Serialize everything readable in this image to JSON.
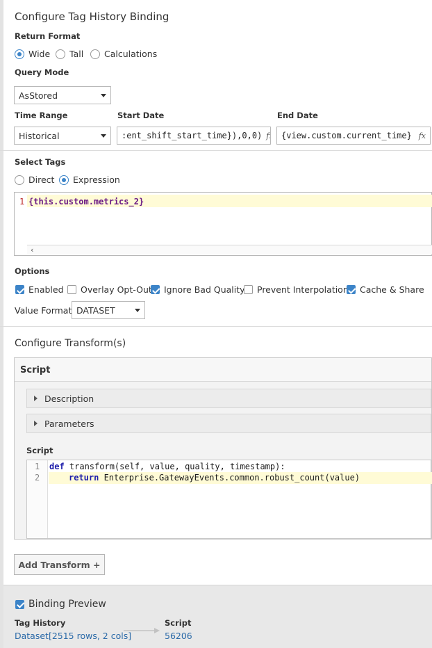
{
  "panel_title": "Configure Tag History Binding",
  "return_format": {
    "label": "Return Format",
    "options": [
      "Wide",
      "Tall",
      "Calculations"
    ],
    "selected": "Wide"
  },
  "query_mode": {
    "label": "Query Mode",
    "value": "AsStored"
  },
  "time_range": {
    "label": "Time Range",
    "value": "Historical"
  },
  "start_date": {
    "label": "Start Date",
    "value": ":ent_shift_start_time}),0,0)",
    "fx": "fx"
  },
  "end_date": {
    "label": "End Date",
    "value": "{view.custom.current_time}",
    "fx": "fx"
  },
  "select_tags": {
    "label": "Select Tags",
    "options": [
      "Direct",
      "Expression"
    ],
    "selected": "Expression",
    "editor": {
      "line_number": "1",
      "expression": "{this.custom.metrics_2}"
    }
  },
  "options": {
    "label": "Options",
    "checkboxes": [
      {
        "label": "Enabled",
        "checked": true
      },
      {
        "label": "Overlay Opt-Out",
        "checked": false
      },
      {
        "label": "Ignore Bad Quality",
        "checked": true
      },
      {
        "label": "Prevent Interpolation",
        "checked": false
      },
      {
        "label": "Cache & Share",
        "checked": true
      }
    ],
    "value_format_label": "Value Format",
    "value_format": "DATASET"
  },
  "transforms": {
    "title": "Configure Transform(s)",
    "script_header": "Script",
    "description_label": "Description",
    "parameters_label": "Parameters",
    "script_label": "Script",
    "code_lines": [
      {
        "num": "1",
        "kw": "def",
        "rest": " transform(self, value, quality, timestamp):"
      },
      {
        "num": "2",
        "kw": "return",
        "rest": " Enterprise.GatewayEvents.common.robust_count(value)"
      }
    ],
    "add_button": "Add Transform +"
  },
  "preview": {
    "label": "Binding Preview",
    "checked": true,
    "tag_history_label": "Tag History",
    "tag_history_value": "Dataset[2515 rows, 2 cols]",
    "script_label": "Script",
    "script_value": "56206"
  },
  "colors": {
    "accent": "#3c84c8",
    "link": "#2b6aa8",
    "highlight": "#fffbd6",
    "keyword": "#1b1baa",
    "expr": "#6a1a84"
  }
}
